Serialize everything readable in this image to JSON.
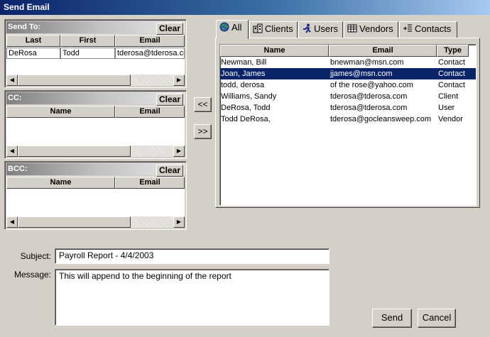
{
  "window": {
    "title": "Send Email"
  },
  "send_to": {
    "title": "Send To:",
    "clear_label": "Clear",
    "columns": [
      "Last",
      "First",
      "Email"
    ],
    "rows": [
      {
        "last": "DeRosa",
        "first": "Todd",
        "email": "tderosa@tderosa.com"
      }
    ]
  },
  "cc": {
    "title": "CC:",
    "clear_label": "Clear",
    "columns": [
      "Name",
      "Email"
    ]
  },
  "bcc": {
    "title": "BCC:",
    "clear_label": "Clear",
    "columns": [
      "Name",
      "Email"
    ]
  },
  "transfer": {
    "add_label": "<<",
    "remove_label": ">>"
  },
  "tabs": [
    {
      "label": "All",
      "icon": "globe-icon"
    },
    {
      "label": "Clients",
      "icon": "building-icon"
    },
    {
      "label": "Users",
      "icon": "runner-icon"
    },
    {
      "label": "Vendors",
      "icon": "grid-icon"
    },
    {
      "label": "Contacts",
      "icon": "list-arrow-icon"
    }
  ],
  "directory": {
    "columns": [
      "Name",
      "Email",
      "Type"
    ],
    "rows": [
      {
        "name": "Newman, Bill",
        "email": "bnewman@msn.com",
        "type": "Contact",
        "selected": false
      },
      {
        "name": "Joan, James",
        "email": "jjames@msn.com",
        "type": "Contact",
        "selected": true
      },
      {
        "name": "todd, derosa",
        "email": "of the rose@yahoo.com",
        "type": "Contact",
        "selected": false
      },
      {
        "name": "Williams, Sandy",
        "email": "tderosa@tderosa.com",
        "type": "Client",
        "selected": false
      },
      {
        "name": "DeRosa, Todd",
        "email": "tderosa@tderosa.com",
        "type": "User",
        "selected": false
      },
      {
        "name": "Todd DeRosa,",
        "email": "tderosa@gocleansweep.com",
        "type": "Vendor",
        "selected": false
      }
    ]
  },
  "compose": {
    "subject_label": "Subject:",
    "subject_value": "Payroll Report - 4/4/2003",
    "message_label": "Message:",
    "message_value": "This will append to the beginning of the report"
  },
  "actions": {
    "send_label": "Send",
    "cancel_label": "Cancel"
  },
  "colors": {
    "title_bar": "#0a246a",
    "selection": "#0a246a",
    "face": "#d4d0c8"
  }
}
